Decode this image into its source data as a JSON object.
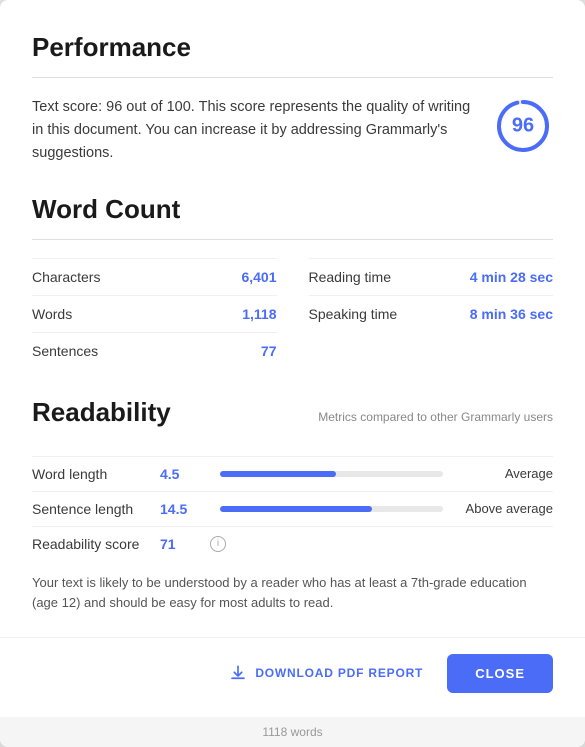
{
  "performance": {
    "title": "Performance",
    "description": "Text score: 96 out of 100. This score represents the quality of writing in this document. You can increase it by addressing Grammarly's suggestions.",
    "score": "96",
    "score_num": 96
  },
  "word_count": {
    "title": "Word Count",
    "stats_left": [
      {
        "label": "Characters",
        "value": "6,401"
      },
      {
        "label": "Words",
        "value": "1,118"
      },
      {
        "label": "Sentences",
        "value": "77"
      }
    ],
    "stats_right": [
      {
        "label": "Reading time",
        "value": "4 min 28 sec"
      },
      {
        "label": "Speaking time",
        "value": "8 min 36 sec"
      }
    ]
  },
  "readability": {
    "title": "Readability",
    "subtitle": "Metrics compared to other Grammarly users",
    "rows": [
      {
        "label": "Word length",
        "value": "4.5",
        "bar_pct": 52,
        "bar_label": "Average"
      },
      {
        "label": "Sentence length",
        "value": "14.5",
        "bar_pct": 68,
        "bar_label": "Above average"
      },
      {
        "label": "Readability score",
        "value": "71",
        "has_info": true,
        "bar_pct": 0,
        "bar_label": ""
      }
    ],
    "note": "Your text is likely to be understood by a reader who has at least a 7th-grade education (age 12) and should be easy for most adults to read."
  },
  "footer": {
    "download_label": "DOWNLOAD PDF REPORT",
    "close_label": "CLOSE"
  },
  "bottom_bar": {
    "text": "1118 words"
  }
}
